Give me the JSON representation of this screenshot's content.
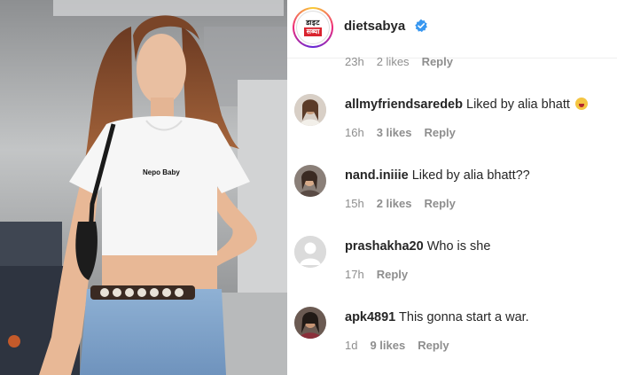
{
  "photo": {
    "shirt_text": "Nepo Baby"
  },
  "post": {
    "username": "dietsabya",
    "brand_line1": "डाइट",
    "brand_line2": "सब्या",
    "verified_icon": "verified-badge-icon"
  },
  "partial": {
    "time": "23h",
    "likes": "2 likes",
    "reply": "Reply"
  },
  "comments": [
    {
      "user": "allmyfriendsaredeb",
      "text": " Liked by alia bhatt",
      "time": "16h",
      "likes": "3 likes",
      "reply": "Reply",
      "emoji": "screaming-face-icon"
    },
    {
      "user": "nand.iniiie",
      "text": " Liked by alia bhatt??",
      "time": "15h",
      "likes": "2 likes",
      "reply": "Reply"
    },
    {
      "user": "prashakha20",
      "text": " Who is she",
      "time": "17h",
      "likes": "",
      "reply": "Reply"
    },
    {
      "user": "apk4891",
      "text": " This gonna start a war.",
      "time": "1d",
      "likes": "9 likes",
      "reply": "Reply"
    }
  ],
  "colors": {
    "text": "#262626",
    "meta": "#8e8e8e",
    "verified": "#3897f0"
  }
}
